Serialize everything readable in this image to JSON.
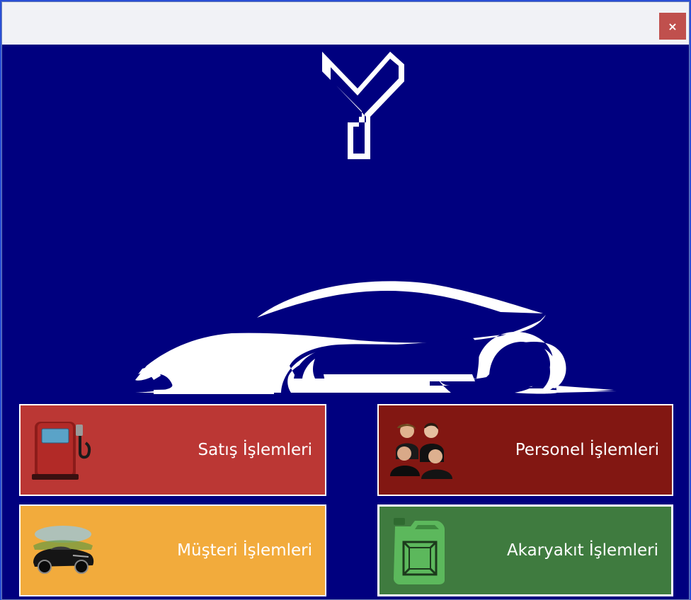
{
  "window": {
    "close_label": "×"
  },
  "tiles": [
    {
      "label": "Satış İşlemleri",
      "color": "#bb3734",
      "icon": "fuel-pump-icon"
    },
    {
      "label": "Personel İşlemleri",
      "color": "#821712",
      "icon": "people-group-icon"
    },
    {
      "label": "Müşteri İşlemleri",
      "color": "#f2ab3c",
      "icon": "car-convertible-icon"
    },
    {
      "label": "Akaryakıt İşlemleri",
      "color": "#3f7b3f",
      "icon": "jerrycan-icon"
    }
  ],
  "colors": {
    "background": "#00007f",
    "titlebar": "#f1f2f6",
    "close_button": "#c0504d",
    "logo": "#ffffff"
  },
  "logo": {
    "icon": "brand-logo-icon"
  },
  "hero": {
    "icon": "sports-car-silhouette-icon"
  }
}
